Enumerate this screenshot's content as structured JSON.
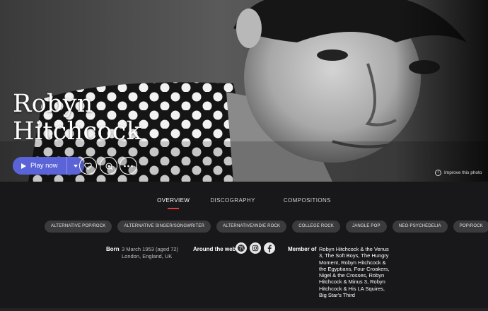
{
  "artist": {
    "name_line1": "Robyn",
    "name_line2": "Hitchcock"
  },
  "actions": {
    "play_label": "Play now",
    "improve_photo": "Improve this photo"
  },
  "tabs": [
    {
      "label": "OVERVIEW",
      "active": true
    },
    {
      "label": "DISCOGRAPHY",
      "active": false
    },
    {
      "label": "COMPOSITIONS",
      "active": false
    }
  ],
  "genres": [
    "ALTERNATIVE POP/ROCK",
    "ALTERNATIVE SINGER/SONGWRITER",
    "ALTERNATIVE/INDIE ROCK",
    "COLLEGE ROCK",
    "JANGLE POP",
    "NEO-PSYCHEDELIA",
    "POP/ROCK"
  ],
  "facts": {
    "born_label": "Born",
    "born_date": "3 March 1953 (aged 72)",
    "born_place": "London, England, UK",
    "web_label": "Around the web",
    "web_icons": [
      "globe-icon",
      "instagram-icon",
      "facebook-icon"
    ],
    "member_label": "Member of",
    "members": [
      "Robyn Hitchcock & the Venus 3",
      "The Soft Boys",
      "The Hungry Moment",
      "Robyn Hitchcock & the Egyptians",
      "Four Croakers",
      "Nigel & the Crosses",
      "Robyn Hitchcock & Minus 3",
      "Robyn Hitchcock & His LA Squires",
      "Big Star's Third"
    ]
  },
  "colors": {
    "accent": "#5a63d8",
    "active_tab_underline": "#e03a3a",
    "background": "#18181a",
    "pill": "#3b3b3d"
  }
}
